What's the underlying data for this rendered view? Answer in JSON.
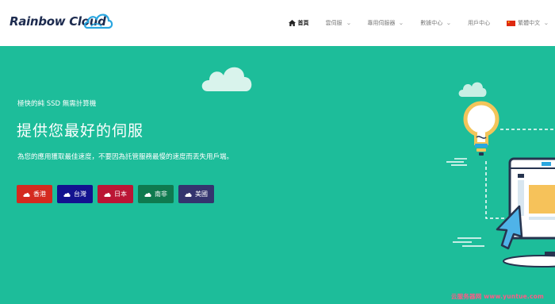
{
  "brand": {
    "logo_text": "Rainbow Cloud"
  },
  "nav": {
    "items": [
      {
        "label": "首頁",
        "active": true
      },
      {
        "label": "雲伺服",
        "has_dropdown": true
      },
      {
        "label": "專用伺服器",
        "has_dropdown": true
      },
      {
        "label": "數據中心",
        "has_dropdown": true
      },
      {
        "label": "用戶中心"
      },
      {
        "label": "繁體中文",
        "has_dropdown": true,
        "icon": "china-flag-icon"
      }
    ]
  },
  "hero": {
    "kicker": "極快的純 SSD 無需計算機",
    "title": "提供您最好的伺服",
    "subtitle": "為您的應用獲取最佳速度，不要因為託管服務最慢的速度而丟失用戶端。",
    "regions": [
      {
        "label": "香港",
        "color": "#d42a1f"
      },
      {
        "label": "台灣",
        "color": "#12128f"
      },
      {
        "label": "日本",
        "color": "#bb1535"
      },
      {
        "label": "南非",
        "color": "#0f7a4f"
      },
      {
        "label": "美國",
        "color": "#34346e"
      }
    ]
  },
  "watermark": "云服务器网 www.yuntue.com",
  "colors": {
    "hero_bg": "#1dbd9a",
    "header_bg": "#ffffff",
    "logo": "#1d2b4f",
    "logo_accent": "#2aa6e0"
  }
}
